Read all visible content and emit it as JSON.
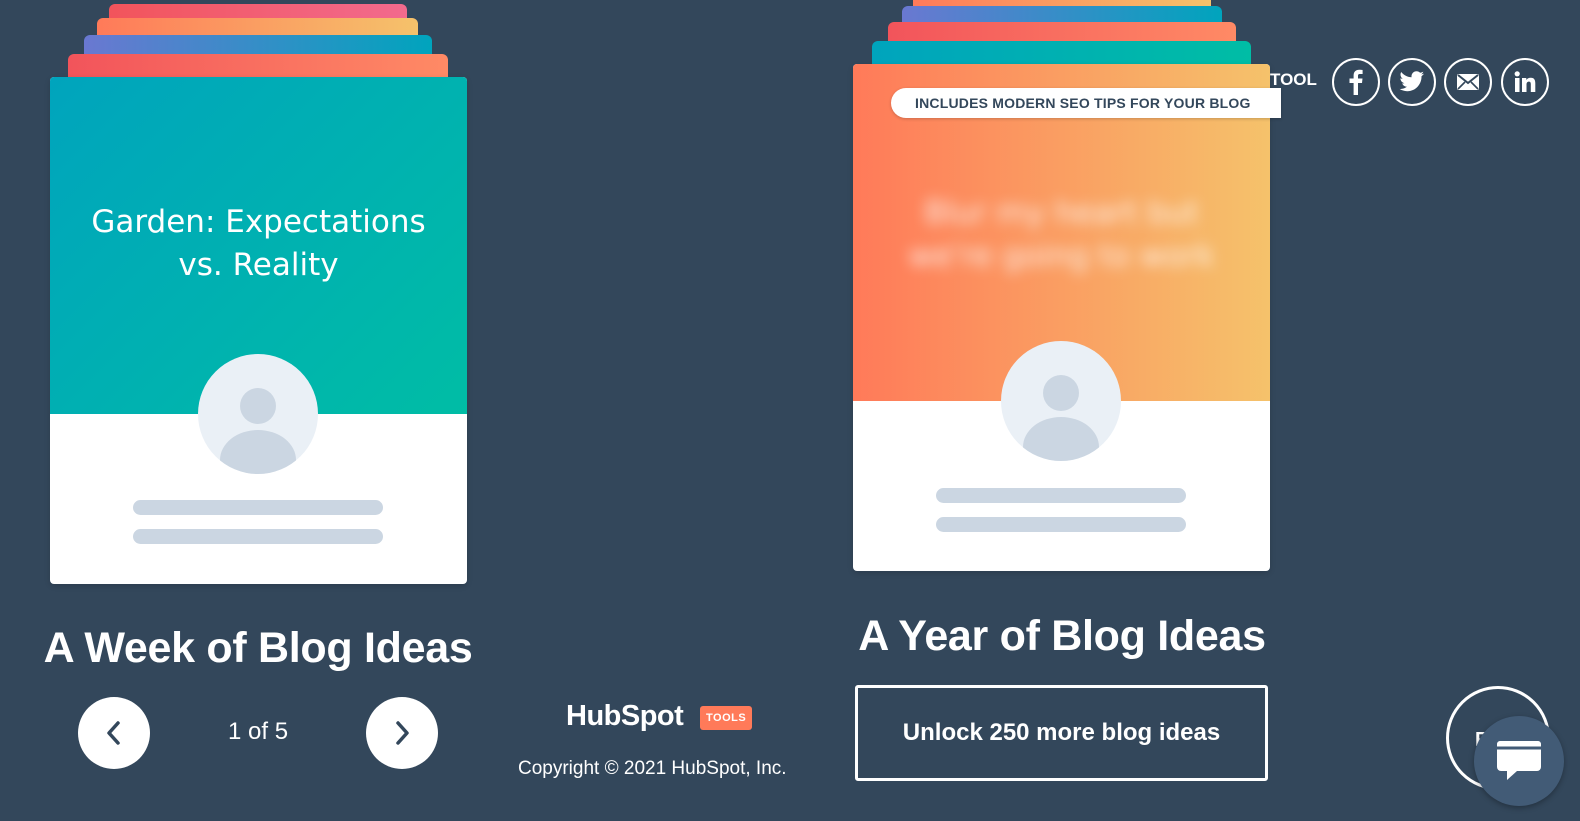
{
  "header": {
    "share_label_partial": "TOOL",
    "social_icons": [
      "facebook-icon",
      "twitter-icon",
      "email-icon",
      "linkedin-icon"
    ]
  },
  "week_card": {
    "title": "Garden: Expectations vs. Reality",
    "heading": "A Week of Blog Ideas",
    "pager": {
      "current": 1,
      "total": 5,
      "text": "1 of 5"
    },
    "colors": {
      "gradient_start": "#00a4bd",
      "gradient_end": "#00bda5"
    }
  },
  "year_card": {
    "pill_text": "INCLUDES MODERN SEO TIPS FOR YOUR BLOG",
    "blurred_title": "Blur my heart but we're going to work",
    "heading": "A Year of Blog Ideas",
    "unlock_button": "Unlock 250 more blog ideas",
    "colors": {
      "gradient_start": "#ff7a59",
      "gradient_end": "#f5c26b"
    }
  },
  "footer": {
    "logo": "HubSpot",
    "logo_badge": "TOOLS",
    "copyright": "Copyright © 2021 HubSpot, Inc."
  },
  "corner": {
    "partial_button_text": "F",
    "chat_icon": "chat-icon"
  },
  "colors": {
    "background": "#33475b",
    "accent": "#ff7a59",
    "placeholder": "#cbd6e2"
  }
}
